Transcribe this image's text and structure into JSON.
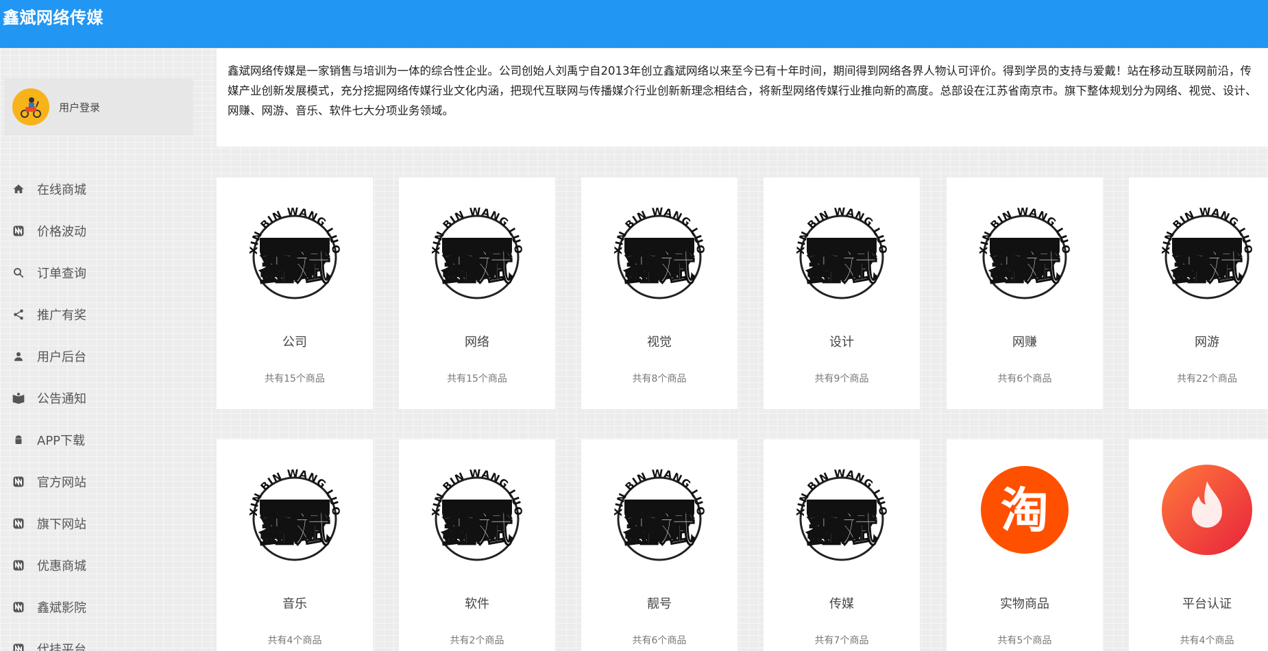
{
  "brand": "鑫斌网络传媒",
  "login": {
    "label": "用户登录"
  },
  "menu": [
    {
      "label": "在线商城",
      "icon": "home-icon"
    },
    {
      "label": "价格波动",
      "icon": "trend-icon"
    },
    {
      "label": "订单查询",
      "icon": "search-icon"
    },
    {
      "label": "推广有奖",
      "icon": "share-icon"
    },
    {
      "label": "用户后台",
      "icon": "user-icon"
    },
    {
      "label": "公告通知",
      "icon": "book-icon"
    },
    {
      "label": "APP下载",
      "icon": "android-icon"
    },
    {
      "label": "官方网站",
      "icon": "link-icon"
    },
    {
      "label": "旗下网站",
      "icon": "link-icon"
    },
    {
      "label": "优惠商城",
      "icon": "link-icon"
    },
    {
      "label": "鑫斌影院",
      "icon": "link-icon"
    },
    {
      "label": "代挂平台",
      "icon": "link-icon"
    }
  ],
  "intro": "鑫斌网络传媒是一家销售与培训为一体的综合性企业。公司创始人刘禹宁自2013年创立鑫斌网络以来至今已有十年时间，期间得到网络各界人物认可评价。得到学员的支持与爱戴！站在移动互联网前沿，传媒产业创新发展模式，充分挖掘网络传媒行业文化内涵，把现代互联网与传播媒介行业创新新理念相结合，将新型网络传媒行业推向新的高度。总部设在江苏省南京市。旗下整体规划分为网络、视觉、设计、网赚、网游、音乐、软件七大分项业务领域。",
  "logo_text": {
    "arc": "XIN BIN WANG LUO",
    "seal": "鑫斌"
  },
  "categories": [
    {
      "name": "公司",
      "count": "共有15个商品",
      "logo": "xinbin-logo"
    },
    {
      "name": "网络",
      "count": "共有15个商品",
      "logo": "xinbin-logo"
    },
    {
      "name": "视觉",
      "count": "共有8个商品",
      "logo": "xinbin-logo"
    },
    {
      "name": "设计",
      "count": "共有9个商品",
      "logo": "xinbin-logo"
    },
    {
      "name": "网赚",
      "count": "共有6个商品",
      "logo": "xinbin-logo"
    },
    {
      "name": "网游",
      "count": "共有22个商品",
      "logo": "xinbin-logo"
    },
    {
      "name": "音乐",
      "count": "共有4个商品",
      "logo": "xinbin-logo"
    },
    {
      "name": "软件",
      "count": "共有2个商品",
      "logo": "xinbin-logo"
    },
    {
      "name": "靓号",
      "count": "共有6个商品",
      "logo": "xinbin-logo"
    },
    {
      "name": "传媒",
      "count": "共有7个商品",
      "logo": "xinbin-logo"
    },
    {
      "name": "实物商品",
      "count": "共有5个商品",
      "logo": "taobao-logo",
      "logo_text": "淘"
    },
    {
      "name": "平台认证",
      "count": "共有4个商品",
      "logo": "fire-logo"
    }
  ],
  "colors": {
    "header": "#2196f3",
    "avatar": "#f8b21a",
    "taobao": "#ff5000",
    "fire": "#f24a3a"
  }
}
